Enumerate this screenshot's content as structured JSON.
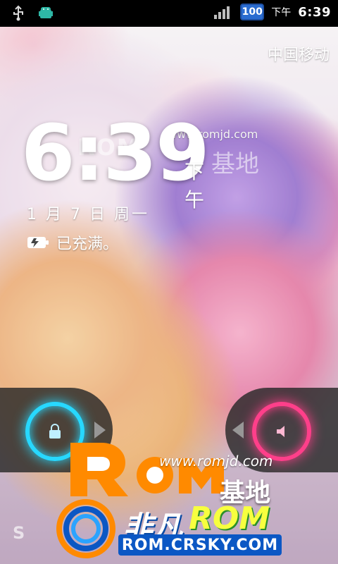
{
  "status_bar": {
    "time_prefix": "下午",
    "time": "6:39",
    "battery": "100",
    "icons": [
      "usb-icon",
      "android-debug-icon",
      "signal-icon",
      "battery-icon"
    ]
  },
  "lockscreen": {
    "carrier": "中国移动",
    "clock_time": "6:39",
    "ampm": "下午",
    "date": "1 月 7 日 周一",
    "charge_status": "已充满。",
    "charge_icon": "charging-icon",
    "lock_icon": "lock-icon",
    "sound_icon": "speaker-icon"
  },
  "watermarks": {
    "top_url": "www.romjd.com",
    "ghost_text": "ROM",
    "ghost_cn": "基地",
    "rom_url": "www.romjd.com",
    "rom_cn": "基地",
    "crsky_cn": "非凡",
    "crsky_rom": "ROM",
    "crsky_url": "ROM.CRSKY.COM",
    "bottom_faint": "S"
  },
  "colors": {
    "status_bar_bg": "#000000",
    "lock_ring": "#27d8ff",
    "sound_ring": "#ff3f8a",
    "battery_fill": "#2a6cd0",
    "rom_orange": "#ff8a00",
    "rom_blue": "#0b57c4"
  }
}
